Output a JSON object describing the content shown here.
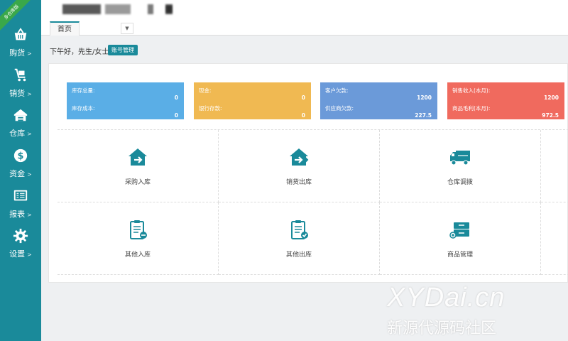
{
  "brand": {
    "ribbon": "多仓库版",
    "accent_color": "#1a8a9a",
    "ribbon_color": "#3aa84a"
  },
  "sidebar": {
    "items": [
      {
        "label": "购货",
        "icon": "basket-icon"
      },
      {
        "label": "销货",
        "icon": "cart-icon"
      },
      {
        "label": "仓库",
        "icon": "warehouse-icon"
      },
      {
        "label": "资金",
        "icon": "dollar-icon"
      },
      {
        "label": "报表",
        "icon": "report-icon"
      },
      {
        "label": "设置",
        "icon": "gear-icon"
      }
    ],
    "chevron": ">"
  },
  "tabs": {
    "active_label": "首页",
    "dropdown": "▼"
  },
  "greeting": {
    "text": "下午好，先生/女士",
    "account_button": "账号管理"
  },
  "stats": [
    {
      "color": "#5aaee6",
      "label1": "库存总量:",
      "value1": "0",
      "label2": "库存成本:",
      "value2": "0"
    },
    {
      "color": "#f0b952",
      "label1": "现金:",
      "value1": "0",
      "label2": "银行存款:",
      "value2": "0"
    },
    {
      "color": "#6b9ad9",
      "label1": "客户欠款:",
      "value1": "1200",
      "label2": "供应商欠款:",
      "value2": "227.5"
    },
    {
      "color": "#f06a5e",
      "label1": "销售收入(本月):",
      "value1": "1200",
      "label2": "商品毛利(本月):",
      "value2": "972.5"
    }
  ],
  "shortcuts": [
    {
      "label": "采购入库",
      "icon": "purchase-in-icon"
    },
    {
      "label": "销货出库",
      "icon": "sales-out-icon"
    },
    {
      "label": "仓库调拨",
      "icon": "truck-icon"
    },
    {
      "label": "其他入库",
      "icon": "clipboard-in-icon"
    },
    {
      "label": "其他出库",
      "icon": "clipboard-out-icon"
    },
    {
      "label": "商品管理",
      "icon": "product-box-icon"
    }
  ],
  "watermark": {
    "line1": "XYDai.cn",
    "line2": "新源代源码社区"
  }
}
